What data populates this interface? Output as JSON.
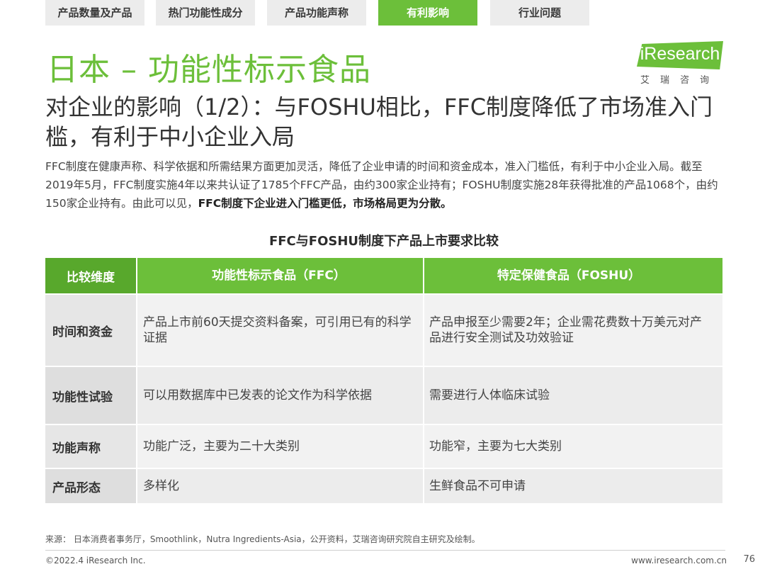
{
  "tabs": [
    {
      "label": "产品数量及产品",
      "active": false
    },
    {
      "label": "热门功能性成分",
      "active": false
    },
    {
      "label": "产品功能声称",
      "active": false
    },
    {
      "label": "有利影响",
      "active": true
    },
    {
      "label": "行业问题",
      "active": false
    }
  ],
  "title": "日本 – 功能性标示食品",
  "logo": {
    "text": "iResearch",
    "cn": "艾瑞咨询",
    "color": "#6cbf3a"
  },
  "subtitle": "对企业的影响（1/2）：与FOSHU相比，FFC制度降低了市场准入门槛，有利于中小企业入局",
  "body": {
    "text": "FFC制度在健康声称、科学依据和所需结果方面更加灵活，降低了企业申请的时间和资金成本，准入门槛低，有利于中小企业入局。截至2019年5月，FFC制度实施4年以来共认证了1785个FFC产品，由约300家企业持有；FOSHU制度实施28年获得批准的产品1068个，由约150家企业持有。由此可以见，",
    "emphasis": "FFC制度下企业进入门槛更低，市场格局更为分散。"
  },
  "table": {
    "title": "FFC与FOSHU制度下产品上市要求比较",
    "headers": [
      "比较维度",
      "功能性标示食品（FFC）",
      "特定保健食品（FOSHU）"
    ],
    "rows": [
      {
        "dimension": "时间和资金",
        "ffc": "产品上市前60天提交资料备案，可引用已有的科学证据",
        "foshu": "产品申报至少需要2年；企业需花费数十万美元对产品进行安全测试及功效验证"
      },
      {
        "dimension": "功能性试验",
        "ffc": "可以用数据库中已发表的论文作为科学依据",
        "foshu": "需要进行人体临床试验"
      },
      {
        "dimension": "功能声称",
        "ffc": "功能广泛，主要为二十大类别",
        "foshu": "功能窄，主要为七大类别"
      },
      {
        "dimension": "产品形态",
        "ffc": "多样化",
        "foshu": "生鲜食品不可申请"
      }
    ]
  },
  "source": "来源： 日本消费者事务厅，Smoothlink，Nutra Ingredients-Asia，公开资料，艾瑞咨询研究院自主研究及绘制。",
  "footer": {
    "copyright": "©2022.4 iResearch Inc.",
    "site": "www.iresearch.com.cn",
    "page": "76"
  },
  "colors": {
    "accent": "#6cbf3a",
    "header_dark": "#58a82c"
  }
}
